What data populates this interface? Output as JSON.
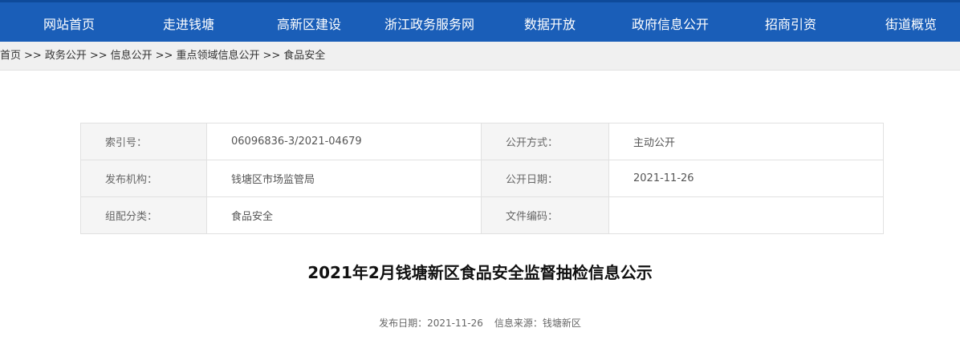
{
  "nav": {
    "items": [
      "网站首页",
      "走进钱塘",
      "高新区建设",
      "浙江政务服务网",
      "数据开放",
      "政府信息公开",
      "招商引资",
      "街道概览"
    ]
  },
  "breadcrumb": {
    "items": [
      "首页",
      "政务公开",
      "信息公开",
      "重点领域信息公开",
      "食品安全"
    ],
    "separator": ">>"
  },
  "meta": {
    "rows": [
      {
        "k1": "索引号：",
        "v1": "06096836-3/2021-04679",
        "k2": "公开方式：",
        "v2": "主动公开"
      },
      {
        "k1": "发布机构：",
        "v1": "钱塘区市场监管局",
        "k2": "公开日期：",
        "v2": "2021-11-26"
      },
      {
        "k1": "组配分类：",
        "v1": "食品安全",
        "k2": "文件编码：",
        "v2": ""
      }
    ]
  },
  "article": {
    "title": "2021年2月钱塘新区食品安全监督抽检信息公示",
    "publish_date": "发布日期：2021-11-26",
    "source": "信息来源：钱塘新区"
  },
  "colors": {
    "nav_bg": "#1a5eb8",
    "breadcrumb_bg": "#f0f0f0",
    "table_key_bg": "#f5f5f5"
  }
}
